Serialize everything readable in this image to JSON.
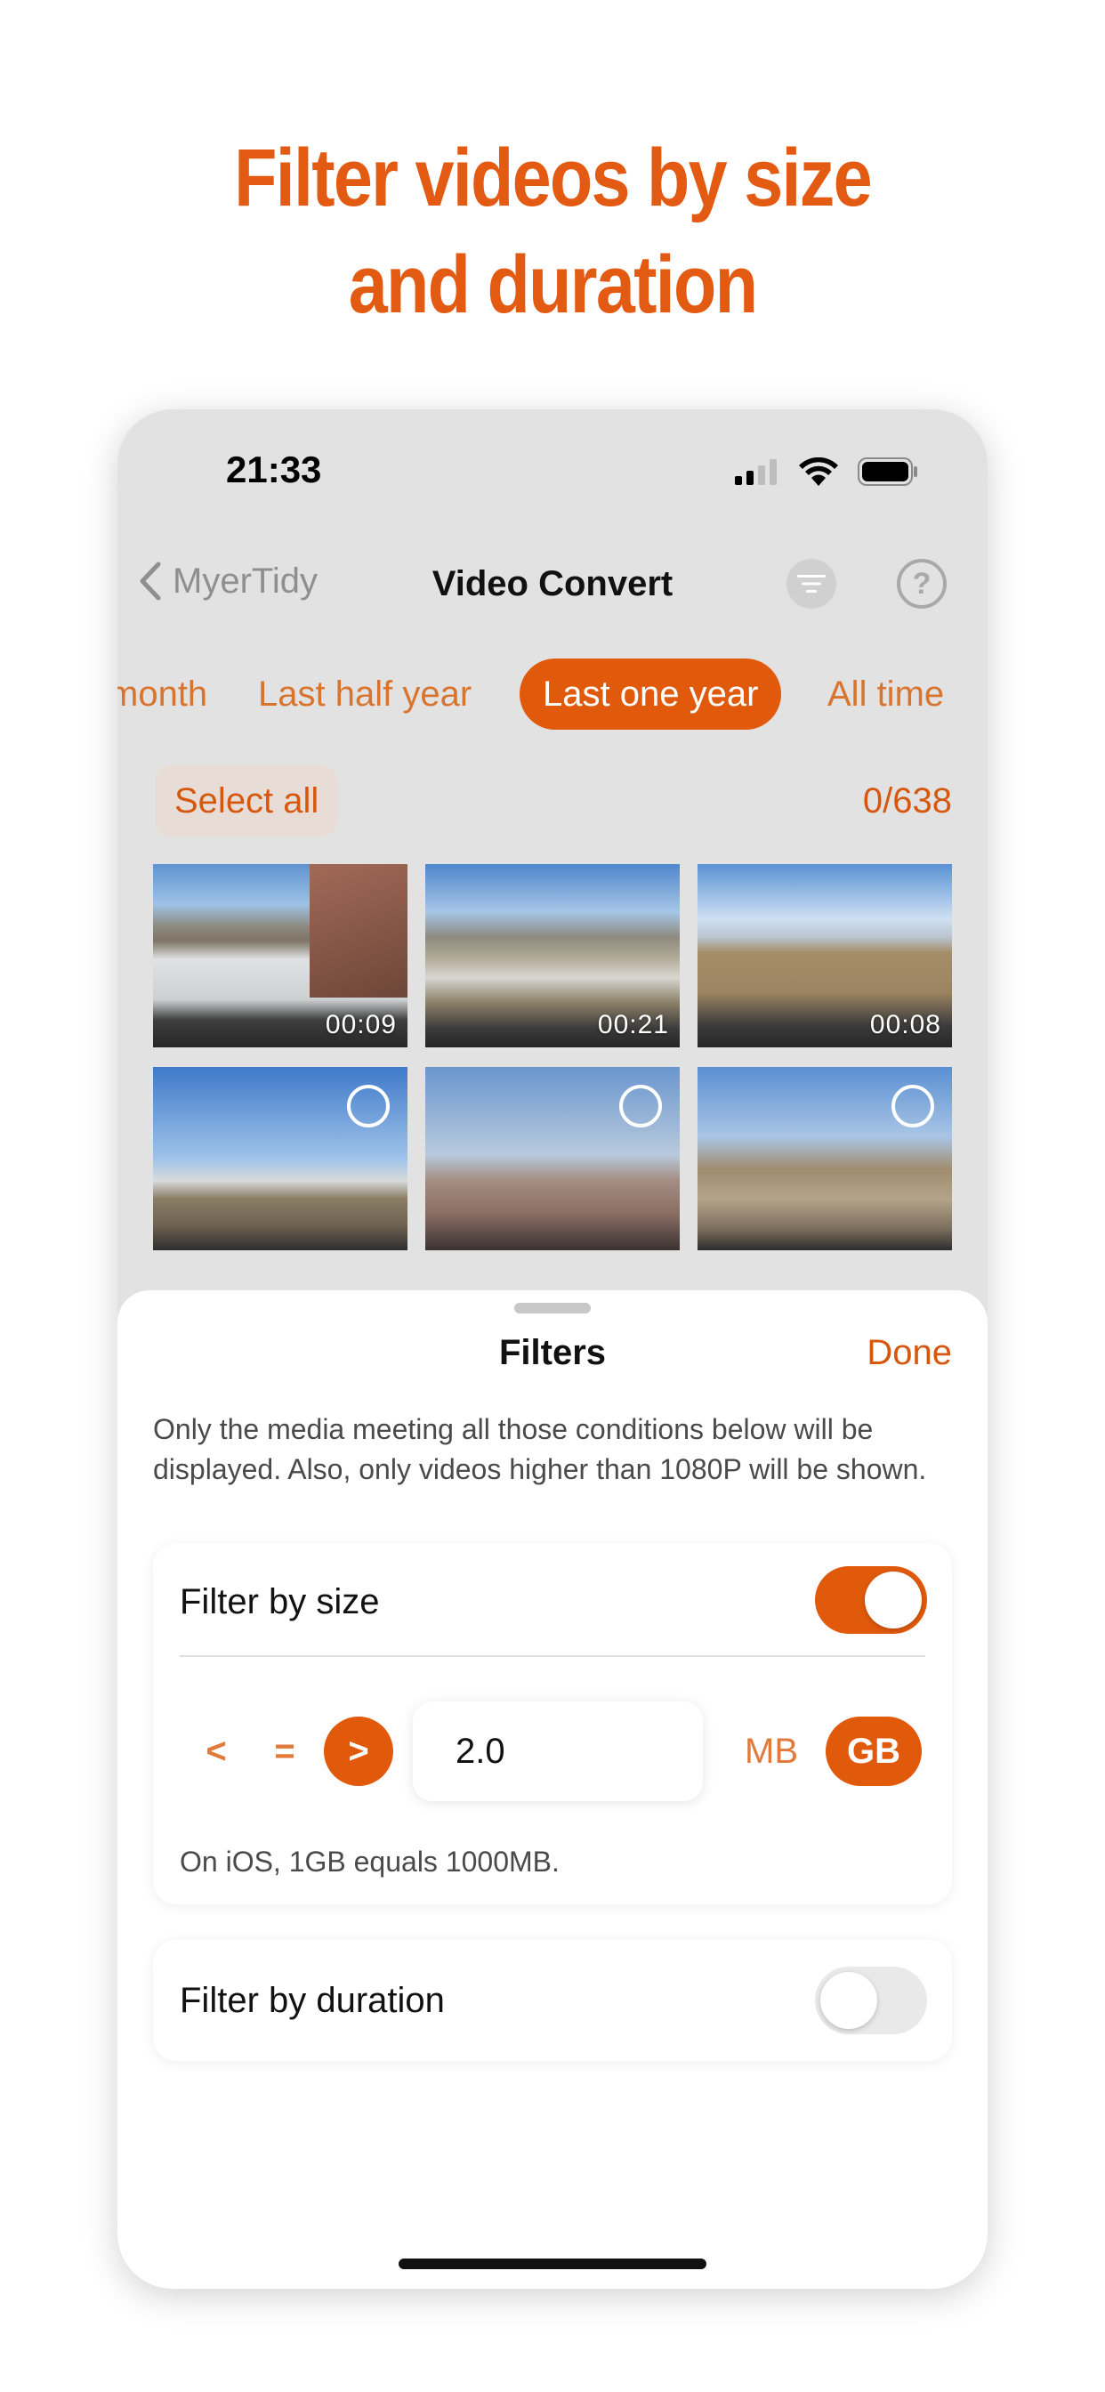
{
  "headline": {
    "line1": "Filter videos by size",
    "line2": "and duration"
  },
  "status_bar": {
    "time": "21:33"
  },
  "nav": {
    "back_label": "MyerTidy",
    "title": "Video Convert"
  },
  "segments": [
    {
      "label": "month",
      "active": false
    },
    {
      "label": "Last half year",
      "active": false
    },
    {
      "label": "Last one year",
      "active": true
    },
    {
      "label": "All time",
      "active": false
    }
  ],
  "selection": {
    "select_all_label": "Select all",
    "count": "0/638"
  },
  "thumbnails": [
    {
      "duration": "00:09"
    },
    {
      "duration": "00:21"
    },
    {
      "duration": "00:08"
    },
    {
      "duration": ""
    },
    {
      "duration": ""
    },
    {
      "duration": ""
    }
  ],
  "sheet": {
    "title": "Filters",
    "done_label": "Done",
    "description": "Only the media meeting all those conditions below will be displayed. Also, only videos higher than 1080P will be shown.",
    "size_filter": {
      "label": "Filter by size",
      "enabled": true,
      "operators": {
        "lt": "<",
        "eq": "=",
        "gt": ">"
      },
      "selected_operator": ">",
      "value": "2.0",
      "units": {
        "mb": "MB",
        "gb": "GB"
      },
      "selected_unit": "GB",
      "note": "On iOS, 1GB equals 1000MB."
    },
    "duration_filter": {
      "label": "Filter by duration",
      "enabled": false
    }
  },
  "colors": {
    "accent": "#e15a0c",
    "headline": "#e35a12"
  }
}
